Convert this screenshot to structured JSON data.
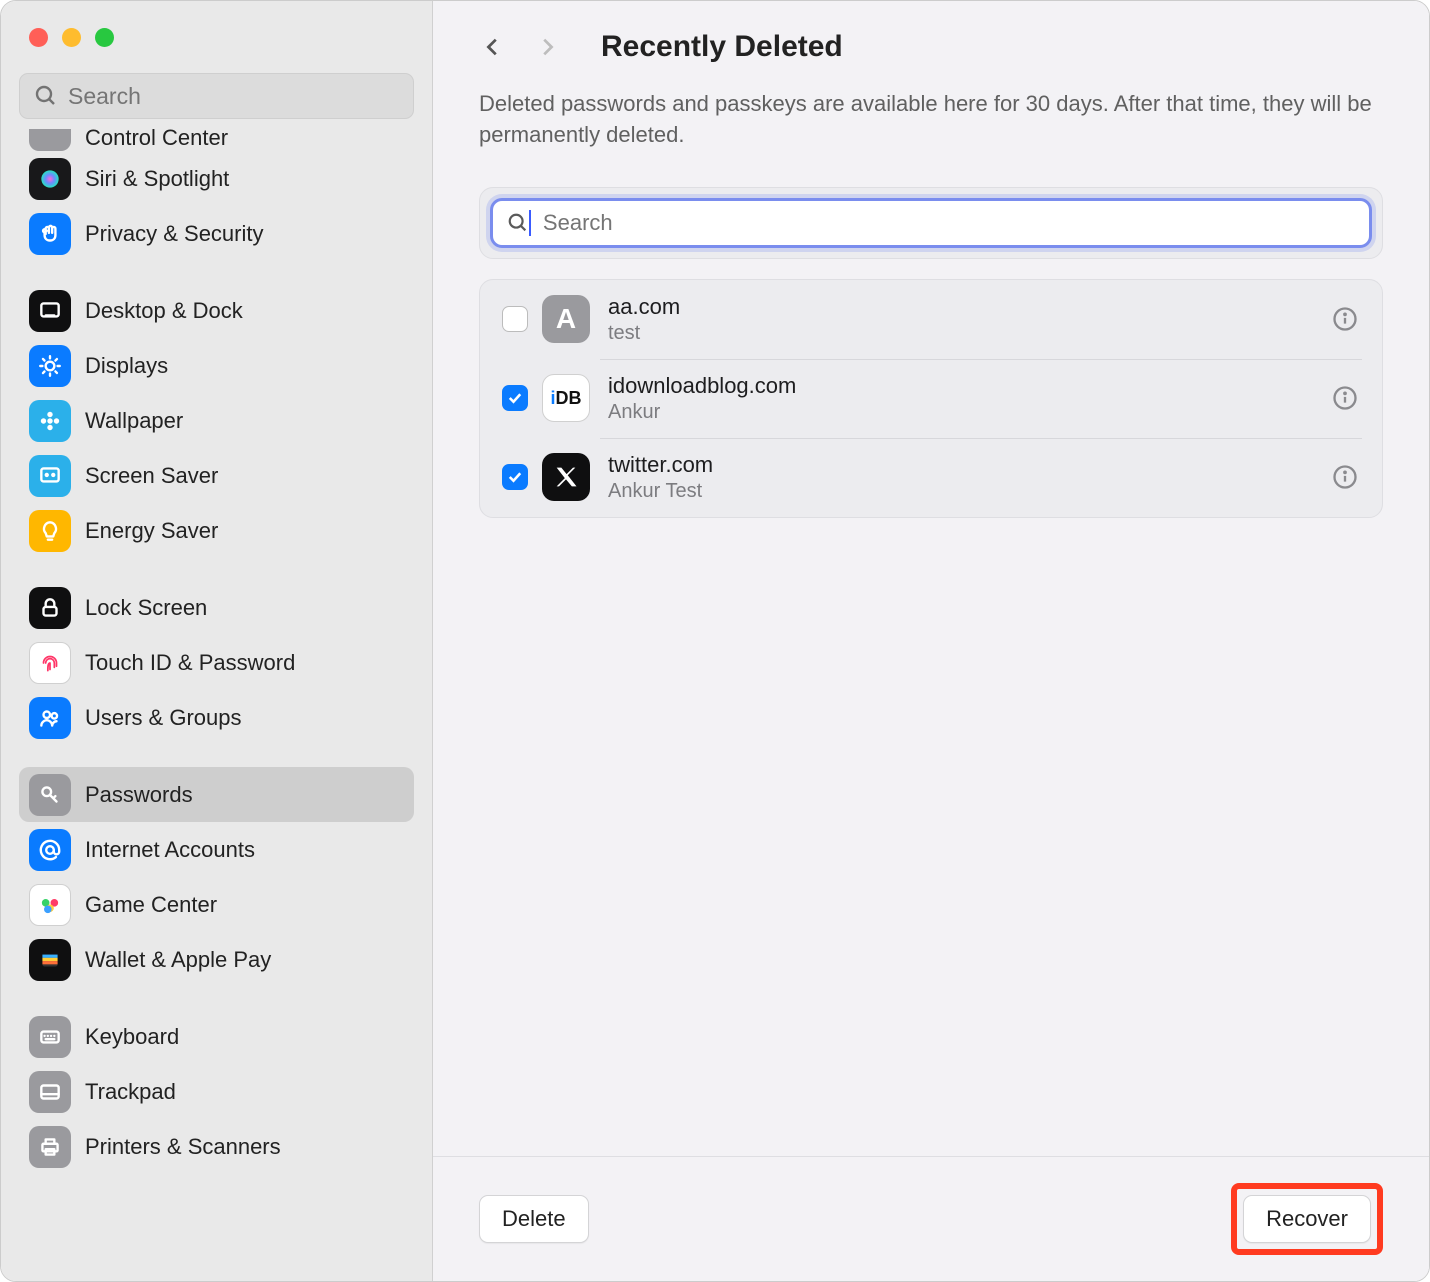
{
  "sidebar_search_placeholder": "Search",
  "sidebar": {
    "clip_item": {
      "label": "Control Center"
    },
    "group1": [
      {
        "label": "Siri & Spotlight",
        "bg": "#18181a",
        "icon": "siri"
      },
      {
        "label": "Privacy & Security",
        "bg": "#0a7bff",
        "icon": "hand"
      }
    ],
    "group2": [
      {
        "label": "Desktop & Dock",
        "bg": "#0f0f10",
        "icon": "dock"
      },
      {
        "label": "Displays",
        "bg": "#0a7bff",
        "icon": "sun"
      },
      {
        "label": "Wallpaper",
        "bg": "#2bb0ea",
        "icon": "flower"
      },
      {
        "label": "Screen Saver",
        "bg": "#2bb0ea",
        "icon": "screensaver"
      },
      {
        "label": "Energy Saver",
        "bg": "#ffb700",
        "icon": "bulb"
      }
    ],
    "group3": [
      {
        "label": "Lock Screen",
        "bg": "#0f0f10",
        "icon": "lock"
      },
      {
        "label": "Touch ID & Password",
        "bg": "#ffffff",
        "icon": "fingerprint"
      },
      {
        "label": "Users & Groups",
        "bg": "#0a7bff",
        "icon": "users"
      }
    ],
    "group4": [
      {
        "label": "Passwords",
        "bg": "#9a9a9e",
        "icon": "key",
        "selected": true
      },
      {
        "label": "Internet Accounts",
        "bg": "#0a7bff",
        "icon": "at"
      },
      {
        "label": "Game Center",
        "bg": "#ffffff",
        "icon": "gamecenter"
      },
      {
        "label": "Wallet & Apple Pay",
        "bg": "#0f0f10",
        "icon": "wallet"
      }
    ],
    "group5": [
      {
        "label": "Keyboard",
        "bg": "#9a9a9e",
        "icon": "keyboard"
      },
      {
        "label": "Trackpad",
        "bg": "#9a9a9e",
        "icon": "trackpad"
      },
      {
        "label": "Printers & Scanners",
        "bg": "#9a9a9e",
        "icon": "printer"
      }
    ]
  },
  "header": {
    "title": "Recently Deleted"
  },
  "subtitle": "Deleted passwords and passkeys are available here for 30 days. After that time, they will be permanently deleted.",
  "panel_search_placeholder": "Search",
  "rows": [
    {
      "title": "aa.com",
      "sub": "test",
      "checked": false,
      "icon_bg": "#9a9a9e",
      "icon_text": "A",
      "icon_kind": "letter"
    },
    {
      "title": "idownloadblog.com",
      "sub": "Ankur",
      "checked": true,
      "icon_bg": "#ffffff",
      "icon_text": "iDB",
      "icon_kind": "idb"
    },
    {
      "title": "twitter.com",
      "sub": "Ankur Test",
      "checked": true,
      "icon_bg": "#0f0f10",
      "icon_text": "X",
      "icon_kind": "x"
    }
  ],
  "buttons": {
    "delete": "Delete",
    "recover": "Recover"
  }
}
